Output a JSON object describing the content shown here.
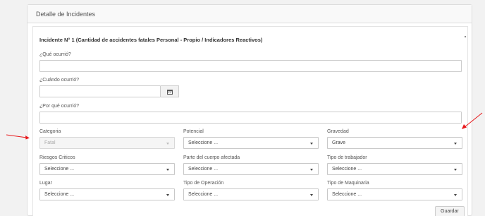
{
  "panel": {
    "heading": "Detalle de Incidentes"
  },
  "incident": {
    "title": "Incidente N° 1 (Cantidad de accidentes fatales Personal - Propio / Indicadores Reactivos)",
    "que_label": "¿Qué ocurrió?",
    "que_value": "",
    "cuando_label": "¿Cuándo ocurrió?",
    "cuando_value": "",
    "porque_label": "¿Por qué ocurrió?",
    "porque_value": ""
  },
  "fields": {
    "categoria": {
      "label": "Categoria",
      "value": "Fatal",
      "disabled": true
    },
    "potencial": {
      "label": "Potencial",
      "value": "Seleccione ..."
    },
    "gravedad": {
      "label": "Gravedad",
      "value": "Grave"
    },
    "riesgos": {
      "label": "Riesgos Criticos",
      "value": "Seleccione ..."
    },
    "parte_cuerpo": {
      "label": "Parte del cuerpo afectada",
      "value": "Seleccione ..."
    },
    "tipo_trabajador": {
      "label": "Tipo de trabajador",
      "value": "Seleccione ..."
    },
    "lugar": {
      "label": "Lugar",
      "value": "Seleccione ..."
    },
    "tipo_operacion": {
      "label": "Tipo de Operación",
      "value": "Seleccione ..."
    },
    "tipo_maquinaria": {
      "label": "Tipo de Maquinaria",
      "value": "Seleccione ..."
    }
  },
  "actions": {
    "save_label": "Guardar"
  },
  "icons": {
    "calendar": "calendar-icon",
    "annotation": "red-arrow-annotation"
  },
  "colors": {
    "annotation": "#e8191c"
  }
}
